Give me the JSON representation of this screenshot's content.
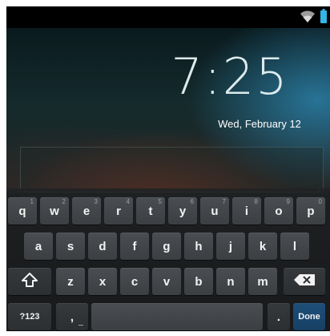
{
  "status_bar": {
    "icons": [
      "wifi-icon",
      "battery-icon"
    ],
    "battery_color": "#33b5e5"
  },
  "lockscreen": {
    "time": "7:25",
    "date": "Wed, February 12"
  },
  "input": {
    "value": ""
  },
  "keyboard": {
    "row1": [
      {
        "label": "q",
        "hint": "1"
      },
      {
        "label": "w",
        "hint": "2"
      },
      {
        "label": "e",
        "hint": "3"
      },
      {
        "label": "r",
        "hint": "4"
      },
      {
        "label": "t",
        "hint": "5"
      },
      {
        "label": "y",
        "hint": "6"
      },
      {
        "label": "u",
        "hint": "7"
      },
      {
        "label": "i",
        "hint": "8"
      },
      {
        "label": "o",
        "hint": "9"
      },
      {
        "label": "p",
        "hint": "0"
      }
    ],
    "row2": [
      "a",
      "s",
      "d",
      "f",
      "g",
      "h",
      "j",
      "k",
      "l"
    ],
    "row3": [
      "z",
      "x",
      "c",
      "v",
      "b",
      "n",
      "m"
    ],
    "symbols_label": "?123",
    "comma_label": ",",
    "period_label": ".",
    "done_label": "Done",
    "accent_color": "#33b5e5"
  }
}
